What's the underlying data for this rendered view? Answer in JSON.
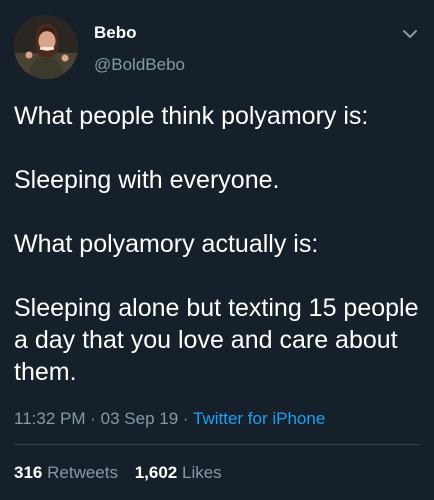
{
  "author": {
    "name": "Bebo",
    "handle": "@BoldBebo"
  },
  "tweet": {
    "paragraphs": [
      "What people think polyamory is:",
      "Sleeping with everyone.",
      "What polyamory actually is:",
      "Sleeping alone but texting 15 people a day that you love and care about them."
    ]
  },
  "meta": {
    "time": "11:32 PM",
    "separator": "·",
    "date": "03 Sep 19",
    "source": "Twitter for iPhone"
  },
  "stats": {
    "retweets_count": "316",
    "retweets_label": "Retweets",
    "likes_count": "1,602",
    "likes_label": "Likes"
  },
  "colors": {
    "background": "#15202b",
    "text_primary": "#ffffff",
    "text_secondary": "#8899a6",
    "link": "#1da1f2",
    "divider": "#38444d"
  },
  "icons": {
    "menu": "chevron-down-icon"
  }
}
